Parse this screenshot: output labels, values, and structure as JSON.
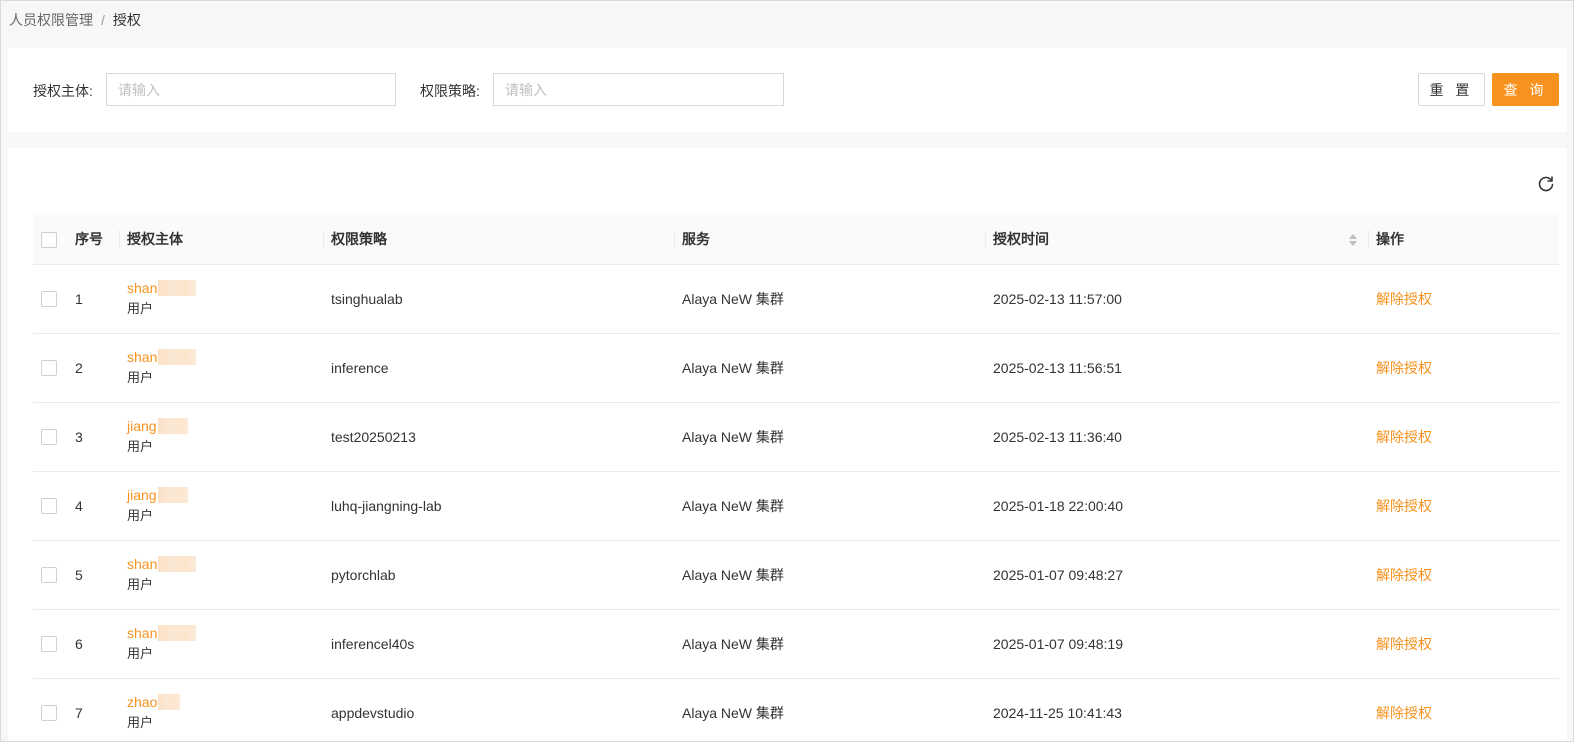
{
  "breadcrumb": {
    "parent": "人员权限管理",
    "separator": "/",
    "current": "授权"
  },
  "filters": {
    "subject_label": "授权主体:",
    "subject_placeholder": "请输入",
    "policy_label": "权限策略:",
    "policy_placeholder": "请输入",
    "reset_label": "重 置",
    "query_label": "查 询"
  },
  "colors": {
    "accent": "#f7921e",
    "border": "#d9d9d9",
    "page_bg": "#f7f7f7"
  },
  "table": {
    "columns": {
      "index": "序号",
      "subject": "授权主体",
      "policy": "权限策略",
      "service": "服务",
      "time": "授权时间",
      "action": "操作"
    },
    "rows": [
      {
        "index": "1",
        "subject": "shan",
        "subject_type": "用户",
        "policy": "tsinghualab",
        "service": "Alaya NeW 集群",
        "time": "2025-02-13 11:57:00",
        "action": "解除授权"
      },
      {
        "index": "2",
        "subject": "shan",
        "subject_type": "用户",
        "policy": "inference",
        "service": "Alaya NeW 集群",
        "time": "2025-02-13 11:56:51",
        "action": "解除授权"
      },
      {
        "index": "3",
        "subject": "jiang",
        "subject_type": "用户",
        "policy": "test20250213",
        "service": "Alaya NeW 集群",
        "time": "2025-02-13 11:36:40",
        "action": "解除授权"
      },
      {
        "index": "4",
        "subject": "jiang",
        "subject_type": "用户",
        "policy": "luhq-jiangning-lab",
        "service": "Alaya NeW 集群",
        "time": "2025-01-18 22:00:40",
        "action": "解除授权"
      },
      {
        "index": "5",
        "subject": "shan",
        "subject_type": "用户",
        "policy": "pytorchlab",
        "service": "Alaya NeW 集群",
        "time": "2025-01-07 09:48:27",
        "action": "解除授权"
      },
      {
        "index": "6",
        "subject": "shan",
        "subject_type": "用户",
        "policy": "inferencel40s",
        "service": "Alaya NeW 集群",
        "time": "2025-01-07 09:48:19",
        "action": "解除授权"
      },
      {
        "index": "7",
        "subject": "zhao",
        "subject_type": "用户",
        "policy": "appdevstudio",
        "service": "Alaya NeW 集群",
        "time": "2024-11-25 10:41:43",
        "action": "解除授权"
      }
    ]
  }
}
